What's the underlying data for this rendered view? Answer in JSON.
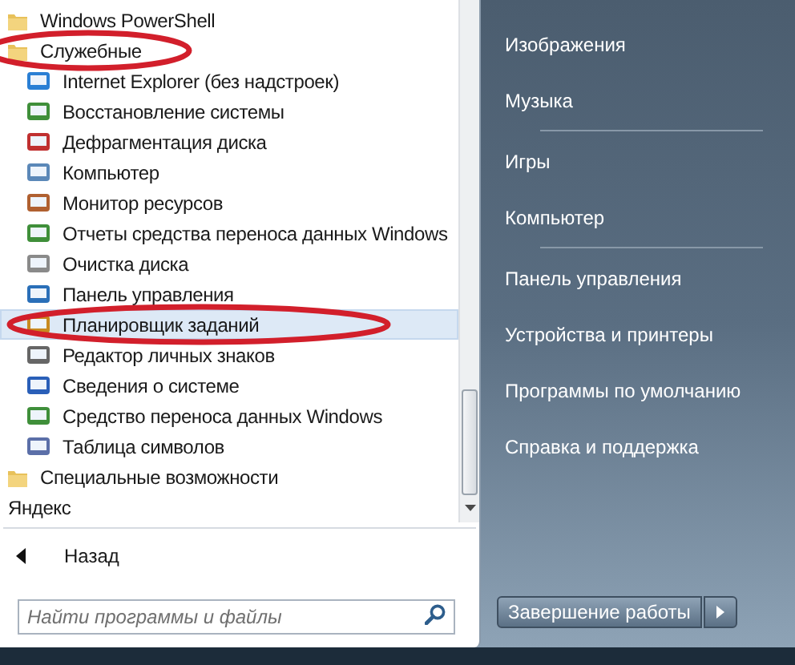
{
  "programs": [
    {
      "label": "Windows PowerShell",
      "kind": "folder",
      "circled": false
    },
    {
      "label": "Служебные",
      "kind": "folder",
      "circled": true,
      "children": [
        {
          "label": "Internet Explorer (без надстроек)",
          "selected": false,
          "circled": false
        },
        {
          "label": "Восстановление системы",
          "selected": false,
          "circled": false
        },
        {
          "label": "Дефрагментация диска",
          "selected": false,
          "circled": false
        },
        {
          "label": "Компьютер",
          "selected": false,
          "circled": false
        },
        {
          "label": "Монитор ресурсов",
          "selected": false,
          "circled": false
        },
        {
          "label": "Отчеты средства переноса данных Windows",
          "selected": false,
          "circled": false
        },
        {
          "label": "Очистка диска",
          "selected": false,
          "circled": false
        },
        {
          "label": "Панель управления",
          "selected": false,
          "circled": false
        },
        {
          "label": "Планировщик заданий",
          "selected": true,
          "circled": true
        },
        {
          "label": "Редактор личных знаков",
          "selected": false,
          "circled": false
        },
        {
          "label": "Сведения о системе",
          "selected": false,
          "circled": false
        },
        {
          "label": "Средство переноса данных Windows",
          "selected": false,
          "circled": false
        },
        {
          "label": "Таблица символов",
          "selected": false,
          "circled": false
        }
      ]
    },
    {
      "label": "Специальные возможности",
      "kind": "folder",
      "circled": false
    },
    {
      "label": "Яндекс",
      "kind": "group",
      "circled": false
    }
  ],
  "back": {
    "label": "Назад"
  },
  "search": {
    "placeholder": "Найти программы и файлы"
  },
  "places": [
    [
      "Изображения",
      "Музыка"
    ],
    [
      "Игры",
      "Компьютер"
    ],
    [
      "Панель управления",
      "Устройства и принтеры",
      "Программы по умолчанию",
      "Справка и поддержка"
    ]
  ],
  "shutdown": {
    "label": "Завершение работы"
  }
}
